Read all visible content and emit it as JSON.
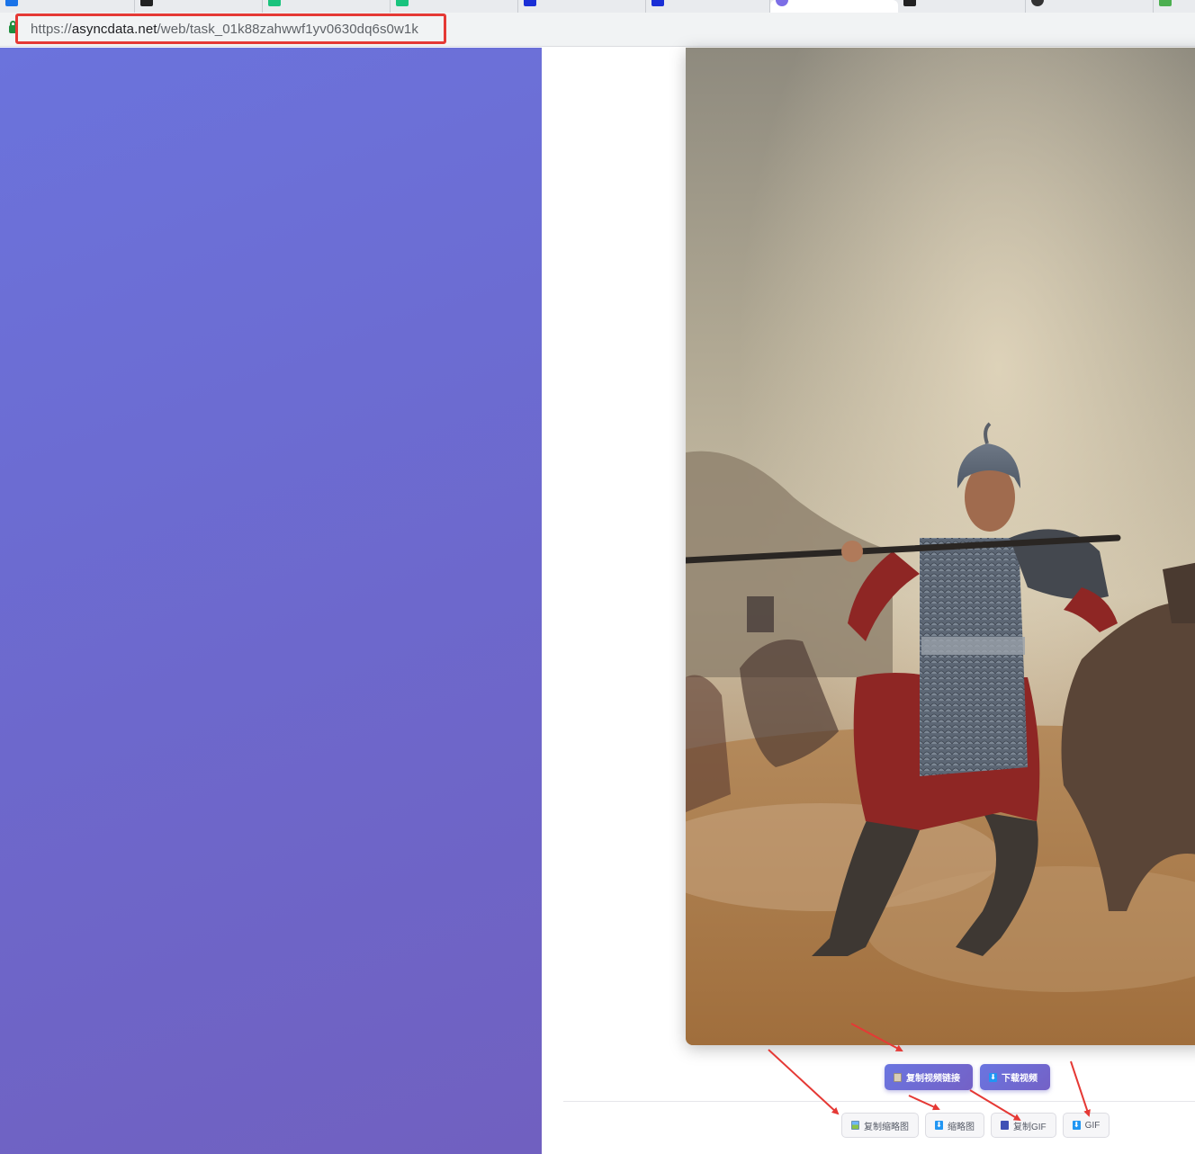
{
  "browser": {
    "tabs": [
      {
        "label": "",
        "favicon_color": "#1a73e8"
      },
      {
        "label": "",
        "favicon_color": "#222222"
      },
      {
        "label": "",
        "favicon_color": "#19c37d"
      },
      {
        "label": "",
        "favicon_color": "#19c37d"
      },
      {
        "label": "",
        "favicon_color": "#1a2fd6"
      },
      {
        "label": "",
        "favicon_color": "#1a2fd6"
      },
      {
        "label": "",
        "favicon_color": "#7c6ee6",
        "active": true
      },
      {
        "label": "",
        "favicon_color": "#222222"
      },
      {
        "label": "",
        "favicon_color": "#333333"
      },
      {
        "label": "",
        "favicon_color": "#4caf50"
      }
    ],
    "url": {
      "scheme": "https://",
      "host": "asyncdata.net",
      "path": "/web/task_01k88zahwwf1yv0630dq6s0w1k"
    },
    "highlight_color": "#e53935"
  },
  "page": {
    "left_gradient": [
      "#6b73dc",
      "#7060c0"
    ],
    "video": {
      "subject": "armored warrior with spear on a dusty battlefield"
    },
    "primary_actions": [
      {
        "label": "复制视频链接",
        "icon": "clipboard-icon"
      },
      {
        "label": "下载视频",
        "icon": "download-icon"
      }
    ],
    "secondary_actions": [
      {
        "label": "复制缩略图",
        "icon": "image-icon"
      },
      {
        "label": "缩略图",
        "icon": "download-icon"
      },
      {
        "label": "复制GIF",
        "icon": "film-icon"
      },
      {
        "label": "GIF",
        "icon": "download-icon"
      }
    ],
    "annotation_color": "#e53935"
  }
}
